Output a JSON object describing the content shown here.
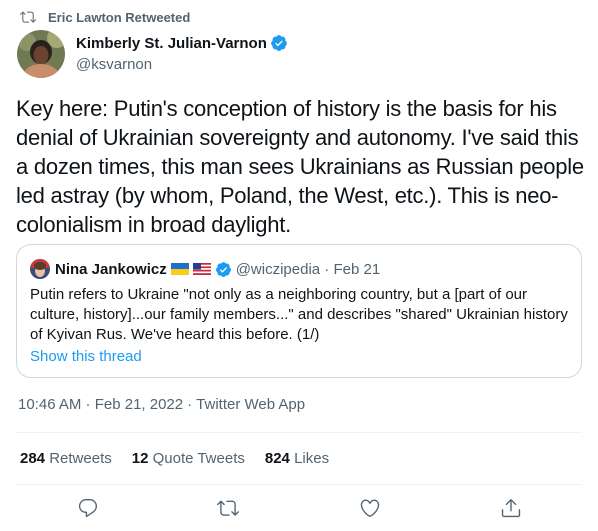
{
  "retweet_header": {
    "text": "Eric Lawton Retweeted",
    "icon": "retweet-icon"
  },
  "author": {
    "name": "Kimberly St. Julian-Varnon",
    "handle": "@ksvarnon",
    "verified": true
  },
  "tweet": {
    "text": "Key here: Putin's conception of history is the basis for his denial of Ukrainian sovereignty and autonomy. I've said this a dozen times, this man sees Ukrainians as Russian people led astray (by whom, Poland, the West, etc.). This is neo-colonialism in broad daylight."
  },
  "quoted_tweet": {
    "name": "Nina Jankowicz",
    "flags": [
      "flag-ukraine-icon",
      "flag-usa-icon"
    ],
    "verified": true,
    "handle_date": "@wiczipedia · Feb 21",
    "text": "Putin refers to Ukraine \"not only as a neighboring country, but a [part of our culture, history]...our family members...\" and describes \"shared\" Ukrainian history of Kyivan Rus. We've heard this before. (1/)",
    "show_thread": "Show this thread"
  },
  "meta": "10:46 AM · Feb 21, 2022 · Twitter Web App",
  "stats": {
    "retweets": {
      "count": "284",
      "label": "Retweets"
    },
    "quotes": {
      "count": "12",
      "label": "Quote Tweets"
    },
    "likes": {
      "count": "824",
      "label": "Likes"
    }
  },
  "actions": [
    "reply-icon",
    "retweet-icon",
    "like-icon",
    "share-icon"
  ],
  "colors": {
    "accent": "#1d9bf0",
    "muted": "#536471",
    "text": "#0f1419",
    "border": "#cfd9de"
  }
}
